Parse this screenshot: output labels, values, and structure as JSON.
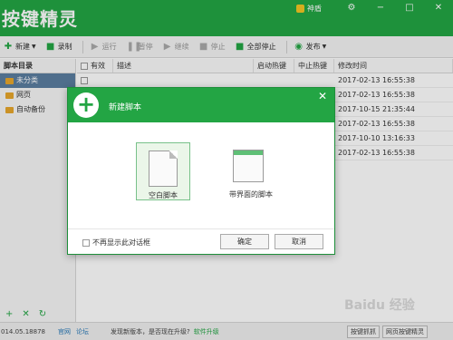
{
  "app": {
    "title": "按键精灵",
    "username": "神盾"
  },
  "window_buttons": [
    "⚙",
    "−",
    "□",
    "✕"
  ],
  "toolbar": {
    "items": [
      {
        "label": "新建",
        "icon": "plus-icon",
        "glyph": "✚",
        "enabled": true,
        "dropdown": true
      },
      {
        "label": "录制",
        "icon": "camera-icon",
        "glyph": "■",
        "enabled": true,
        "dropdown": false
      },
      {
        "label": "运行",
        "icon": "play-icon",
        "glyph": "▶",
        "enabled": false,
        "dropdown": false
      },
      {
        "label": "暂停",
        "icon": "pause-icon",
        "glyph": "❚❚",
        "enabled": false,
        "dropdown": false
      },
      {
        "label": "继续",
        "icon": "resume-icon",
        "glyph": "▶",
        "enabled": false,
        "dropdown": false
      },
      {
        "label": "停止",
        "icon": "stop-icon",
        "glyph": "■",
        "enabled": false,
        "dropdown": false
      },
      {
        "label": "全部停止",
        "icon": "stop-all-icon",
        "glyph": "■",
        "enabled": true,
        "dropdown": false
      },
      {
        "label": "发布",
        "icon": "publish-icon",
        "glyph": "◉",
        "enabled": true,
        "dropdown": true
      }
    ]
  },
  "sidebar": {
    "title": "脚本目录",
    "folders": [
      {
        "label": "未分类",
        "selected": true
      },
      {
        "label": "网页",
        "selected": false
      },
      {
        "label": "自动备份",
        "selected": false
      }
    ],
    "bottom_buttons": [
      "+",
      "✕",
      "↻"
    ]
  },
  "table": {
    "headers": [
      "有效",
      "描述",
      "启动热键",
      "中止热键",
      "修改时间"
    ],
    "rows": [
      {
        "desc": "",
        "start": "",
        "stop": "",
        "modified": "2017-02-13 16:55:38"
      },
      {
        "desc": "",
        "start": "",
        "stop": "",
        "modified": "2017-02-13 16:55:38"
      },
      {
        "desc": "",
        "start": "",
        "stop": "",
        "modified": "2017-10-15 21:35:44"
      },
      {
        "desc": "",
        "start": "",
        "stop": "",
        "modified": "2017-02-13 16:55:38"
      },
      {
        "desc": "",
        "start": "",
        "stop": "",
        "modified": "2017-10-10 13:16:33"
      },
      {
        "desc": "",
        "start": "",
        "stop": "",
        "modified": "2017-02-13 16:55:38"
      }
    ]
  },
  "statusbar": {
    "version": "014.05.18878",
    "links": [
      "官网",
      "论坛"
    ],
    "message": "发现新版本，是否现在升级?",
    "upgrade": "软件升级",
    "right_buttons": [
      "按键抓抓",
      "网页按键精灵"
    ]
  },
  "dialog": {
    "title": "新建脚本",
    "close": "✕",
    "options": [
      {
        "label": "空白脚本",
        "selected": true
      },
      {
        "label": "带界面的脚本",
        "selected": false
      }
    ],
    "dont_show": "不再显示此对话框",
    "ok": "确定",
    "cancel": "取消"
  },
  "watermark": "Baidu 经验",
  "colors": {
    "brand": "#23a544",
    "selected_folder": "#5b7ea0"
  }
}
